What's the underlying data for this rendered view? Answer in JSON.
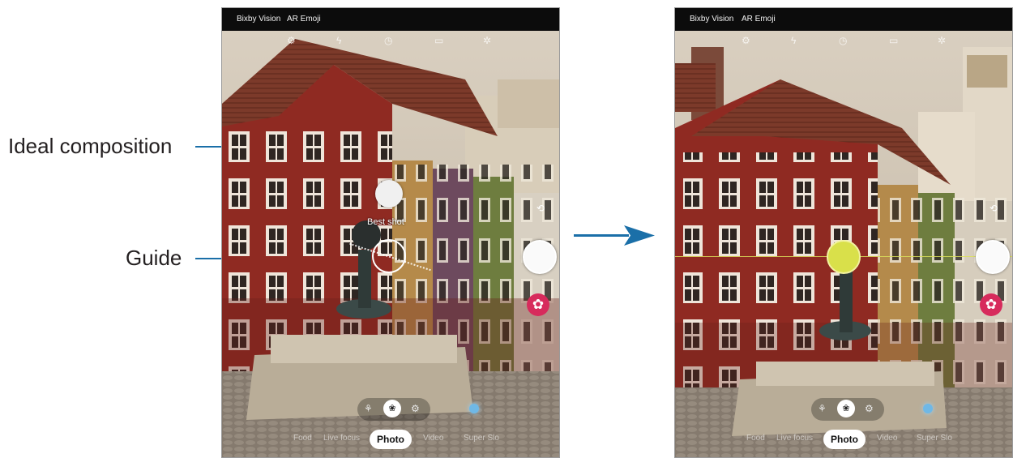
{
  "callouts": {
    "ideal_composition": "Ideal composition",
    "guide": "Guide"
  },
  "arrow_color": "#1a6fa8",
  "top_bar": {
    "bixby_vision": "Bixby Vision",
    "ar_emoji": "AR Emoji"
  },
  "camera_icons": [
    "settings-icon",
    "flash-icon",
    "timer-icon",
    "aspect-ratio-icon",
    "filter-icon"
  ],
  "best_shot": "Best shot",
  "focus_options": [
    "⚘",
    "❀",
    "⚙"
  ],
  "modes": {
    "left": "Live focus",
    "photo": "Photo",
    "right": "Video",
    "far_right": "Super Slo"
  },
  "colors": {
    "guide_yellow": "#d9e04a",
    "effect_pink": "#d72b5c",
    "leader_blue": "#1a6fa8"
  }
}
